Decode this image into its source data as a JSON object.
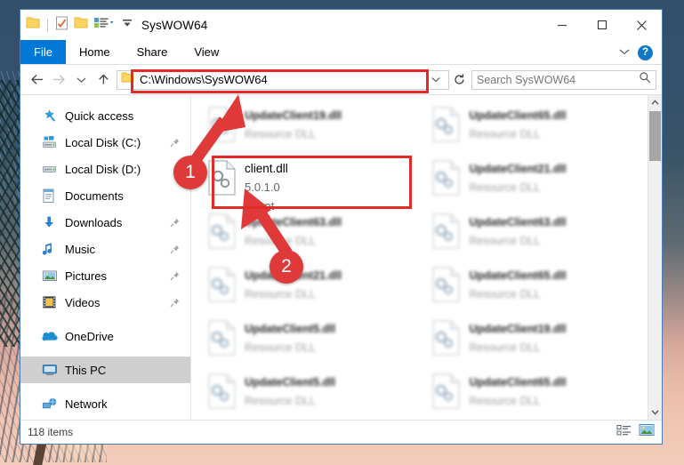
{
  "window": {
    "title": "SysWOW64",
    "quick_access_toolbar": [
      {
        "name": "folder-icon",
        "label": "Folder"
      },
      {
        "name": "properties-icon",
        "label": "Properties"
      },
      {
        "name": "new-folder-icon",
        "label": "New folder"
      },
      {
        "name": "customize-view-icon",
        "label": "Customize"
      },
      {
        "name": "customize-qat-icon",
        "label": "Customize Quick Access Toolbar"
      }
    ],
    "controls": {
      "minimize": "Minimize",
      "maximize": "Maximize",
      "close": "Close",
      "ribbon_toggle": "Minimize the Ribbon",
      "help": "?"
    }
  },
  "ribbon": {
    "tabs": [
      {
        "label": "File",
        "active": true
      },
      {
        "label": "Home",
        "active": false
      },
      {
        "label": "Share",
        "active": false
      },
      {
        "label": "View",
        "active": false
      }
    ]
  },
  "address_bar": {
    "back": "Back",
    "forward": "Forward",
    "recent": "Recent locations",
    "up": "Up",
    "path": "C:\\Windows\\SysWOW64",
    "refresh": "Refresh"
  },
  "search": {
    "placeholder": "Search SysWOW64"
  },
  "sidebar": {
    "items": [
      {
        "label": "Quick access",
        "icon": "star-icon",
        "pinned": false,
        "selected": false,
        "gap_after": false
      },
      {
        "label": "Local Disk (C:)",
        "icon": "drive-windows-icon",
        "pinned": true,
        "selected": false,
        "gap_after": false
      },
      {
        "label": "Local Disk (D:)",
        "icon": "drive-icon",
        "pinned": false,
        "selected": false,
        "gap_after": false
      },
      {
        "label": "Documents",
        "icon": "documents-icon",
        "pinned": false,
        "selected": false,
        "gap_after": false
      },
      {
        "label": "Downloads",
        "icon": "downloads-icon",
        "pinned": true,
        "selected": false,
        "gap_after": false
      },
      {
        "label": "Music",
        "icon": "music-icon",
        "pinned": true,
        "selected": false,
        "gap_after": false
      },
      {
        "label": "Pictures",
        "icon": "pictures-icon",
        "pinned": true,
        "selected": false,
        "gap_after": false
      },
      {
        "label": "Videos",
        "icon": "videos-icon",
        "pinned": true,
        "selected": false,
        "gap_after": true
      },
      {
        "label": "OneDrive",
        "icon": "onedrive-icon",
        "pinned": false,
        "selected": false,
        "gap_after": true
      },
      {
        "label": "This PC",
        "icon": "thispc-icon",
        "pinned": false,
        "selected": true,
        "gap_after": true
      },
      {
        "label": "Network",
        "icon": "network-icon",
        "pinned": false,
        "selected": false,
        "gap_after": false
      }
    ]
  },
  "files": [
    {
      "name": "UpdateClient19.dll",
      "line2": "",
      "line3": "Resource DLL",
      "highlight": false
    },
    {
      "name": "UpdateClient65.dll",
      "line2": "",
      "line3": "Resource DLL",
      "highlight": false
    },
    {
      "name": "client.dll",
      "line2": "5.0.1.0",
      "line3": "Client",
      "highlight": true
    },
    {
      "name": "UpdateClient21.dll",
      "line2": "",
      "line3": "Resource DLL",
      "highlight": false
    },
    {
      "name": "UpdateClient63.dll",
      "line2": "",
      "line3": "Resource DLL",
      "highlight": false
    },
    {
      "name": "UpdateClient63.dll",
      "line2": "",
      "line3": "Resource DLL",
      "highlight": false
    },
    {
      "name": "UpdateClient21.dll",
      "line2": "",
      "line3": "Resource DLL",
      "highlight": false
    },
    {
      "name": "UpdateClient65.dll",
      "line2": "",
      "line3": "Resource DLL",
      "highlight": false
    },
    {
      "name": "UpdateClient5.dll",
      "line2": "",
      "line3": "Resource DLL",
      "highlight": false
    },
    {
      "name": "UpdateClient19.dll",
      "line2": "",
      "line3": "Resource DLL",
      "highlight": false
    },
    {
      "name": "UpdateClient5.dll",
      "line2": "",
      "line3": "Resource DLL",
      "highlight": false
    },
    {
      "name": "UpdateClient65.dll",
      "line2": "",
      "line3": "Resource DLL",
      "highlight": false
    }
  ],
  "status_bar": {
    "items_count": "118 items",
    "view_details": "Details view",
    "view_large_icons": "Large icons view"
  },
  "annotations": {
    "badge_one": "1",
    "badge_two": "2",
    "accent_color": "#e0393a",
    "highlight_border_color": "#e02b26"
  }
}
